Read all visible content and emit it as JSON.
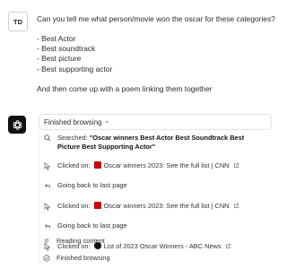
{
  "user": {
    "avatar": "TD",
    "question": "Can you tell me what person/movie won the oscar for these categories?",
    "categories": [
      "- Best Actor",
      "- Best soundtrack",
      "- Best picture",
      "- Best supporting actor"
    ],
    "followup": "And then come up with a poem linking them together"
  },
  "browsing": {
    "header": "Finished browsing",
    "caret": "^",
    "searched_label": "Searched:",
    "searched_query": "\"Oscar winners Best Actor Best Soundtrack Best Picture Best Supporting Actor\"",
    "steps": [
      {
        "label": "Clicked on:",
        "link": "Oscar winners 2023: See the full list | CNN"
      },
      {
        "text": "Going back to last page"
      },
      {
        "label": "Clicked on:",
        "link": "Oscar winners 2023: See the full list | CNN"
      },
      {
        "text": "Going back to last page"
      },
      {
        "label": "Clicked on:",
        "link": "List of 2023 Oscar Winners - ABC News"
      },
      {
        "text": "Reading content"
      },
      {
        "text": "Finished browsing"
      }
    ]
  },
  "colors": {
    "cnn": "#cc0000",
    "abc": "#111111"
  }
}
